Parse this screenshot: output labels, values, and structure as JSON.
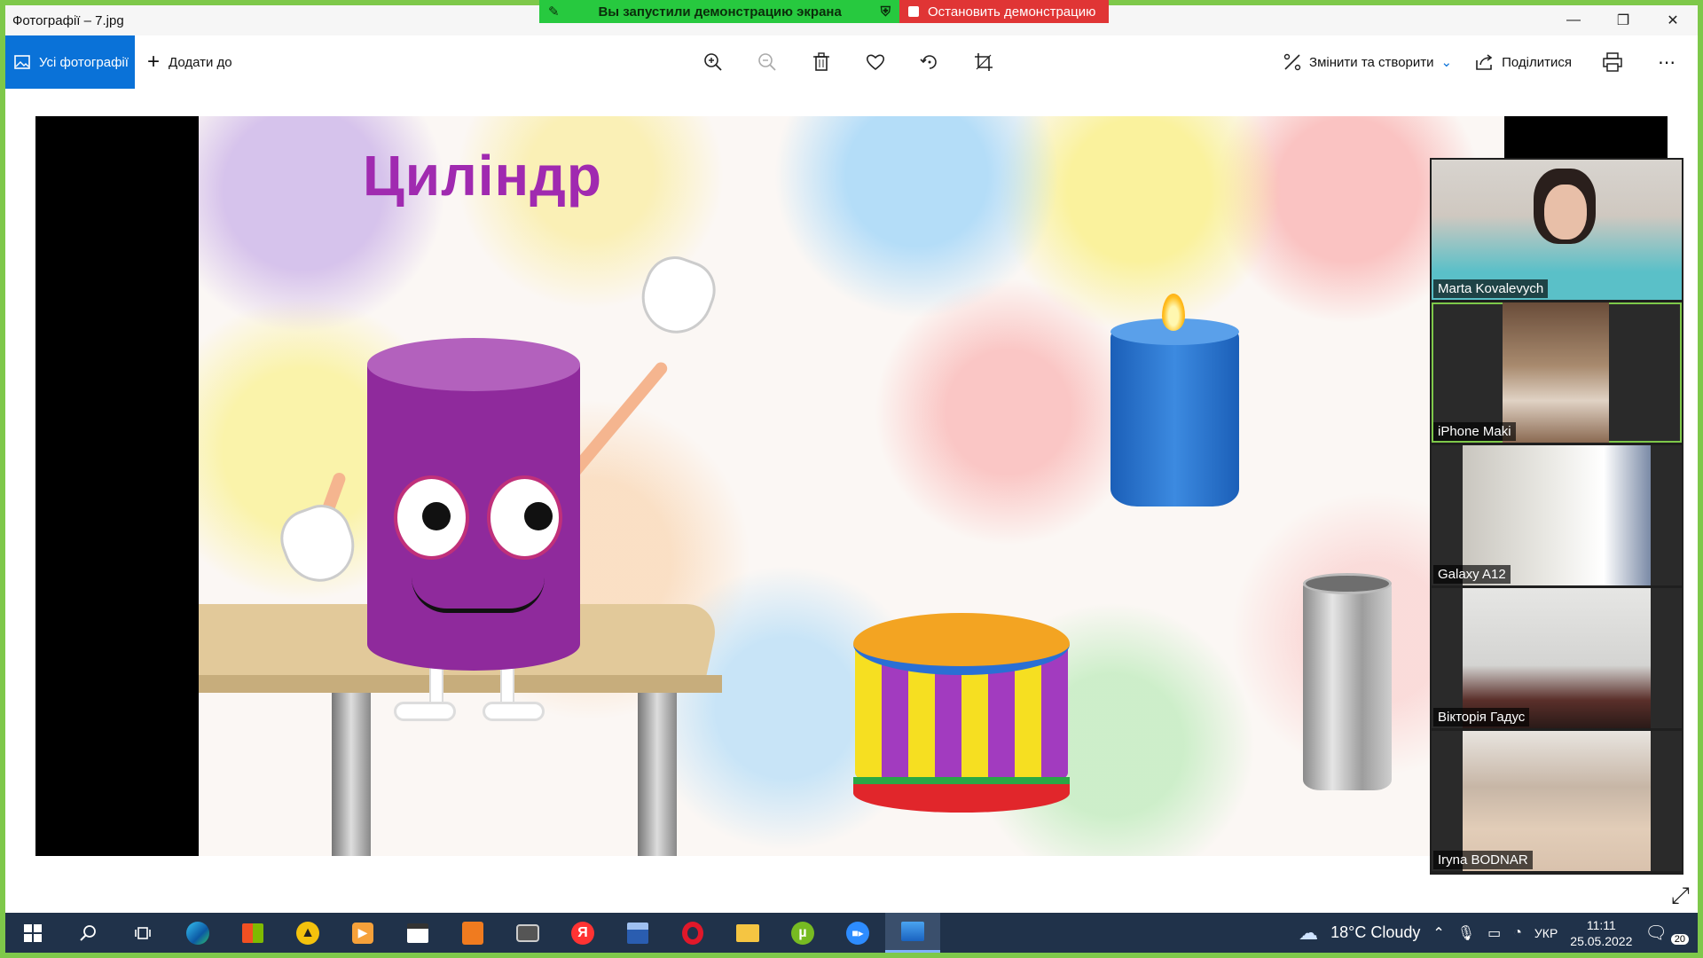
{
  "window": {
    "title": "Фотографії – 7.jpg",
    "controls": [
      "—",
      "❐",
      "✕"
    ]
  },
  "share_banner": {
    "status_text": "Вы запустили демонстрацию экрана",
    "stop_label": "Остановить демонстрацию"
  },
  "toolbar": {
    "all_photos_label": "Усі фотографії",
    "add_to_label": "Додати до",
    "edit_create_label": "Змінити та створити",
    "share_label": "Поділитися",
    "more_label": "⋯"
  },
  "slide": {
    "title": "Циліндр"
  },
  "participants": [
    {
      "name": "Marta Kovalevych"
    },
    {
      "name": "iPhone Maki"
    },
    {
      "name": "Galaxy A12"
    },
    {
      "name": "Вікторія Гадус"
    },
    {
      "name": "Iryna BODNAR"
    }
  ],
  "taskbar": {
    "weather": "18°C  Cloudy",
    "language": "УКР",
    "time": "11:11",
    "date": "25.05.2022",
    "notifications": "20"
  },
  "colors": {
    "share_border": "#7ec84a",
    "accent": "#0a72d8",
    "share_green": "#27c93f",
    "share_red": "#e03535"
  }
}
